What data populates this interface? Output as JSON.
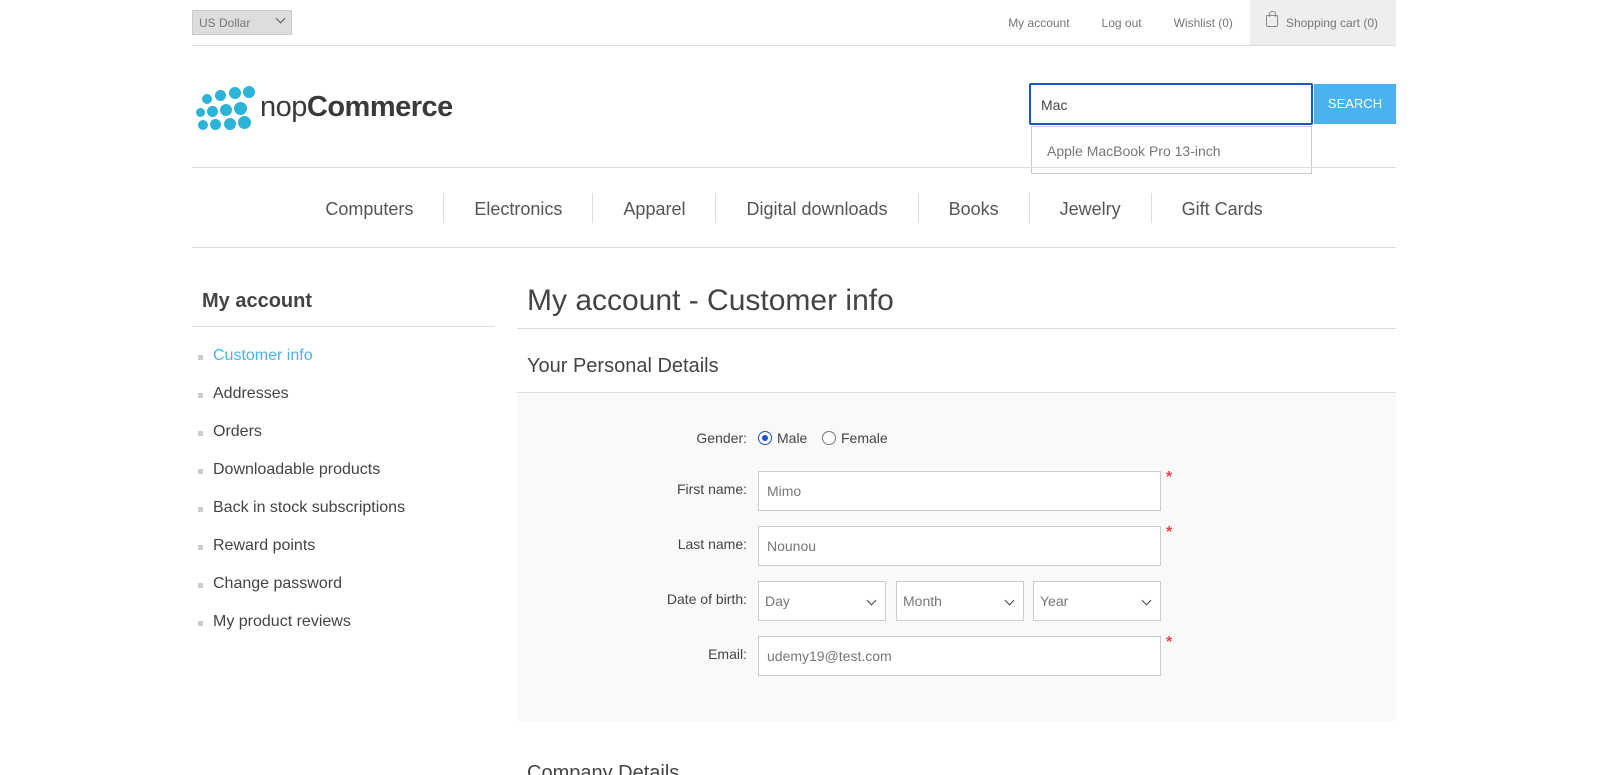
{
  "header": {
    "currency": "US Dollar",
    "links": [
      "My account",
      "Log out",
      "Wishlist (0)"
    ],
    "cart": "Shopping cart (0)"
  },
  "logo": {
    "part1": "nop",
    "part2": "Commerce"
  },
  "search": {
    "value": "Mac",
    "button": "SEARCH",
    "suggestion": "Apple MacBook Pro 13-inch"
  },
  "menu": [
    "Computers",
    "Electronics",
    "Apparel",
    "Digital downloads",
    "Books",
    "Jewelry",
    "Gift Cards"
  ],
  "sidebar": {
    "title": "My account",
    "items": [
      "Customer info",
      "Addresses",
      "Orders",
      "Downloadable products",
      "Back in stock subscriptions",
      "Reward points",
      "Change password",
      "My product reviews"
    ]
  },
  "page": {
    "title": "My account - Customer info",
    "section": "Your Personal Details",
    "section2": "Company Details"
  },
  "form": {
    "gender_label": "Gender:",
    "male": "Male",
    "female": "Female",
    "first_name_label": "First name:",
    "first_name": "Mimo",
    "last_name_label": "Last name:",
    "last_name": "Nounou",
    "dob_label": "Date of birth:",
    "day": "Day",
    "month": "Month",
    "year": "Year",
    "email_label": "Email:",
    "email": "udemy19@test.com",
    "required": "*"
  },
  "colors": {
    "accent": "#4ab2f1",
    "focus": "#1a56c8",
    "required": "#e4444c",
    "logo": "#2cb3d8"
  }
}
